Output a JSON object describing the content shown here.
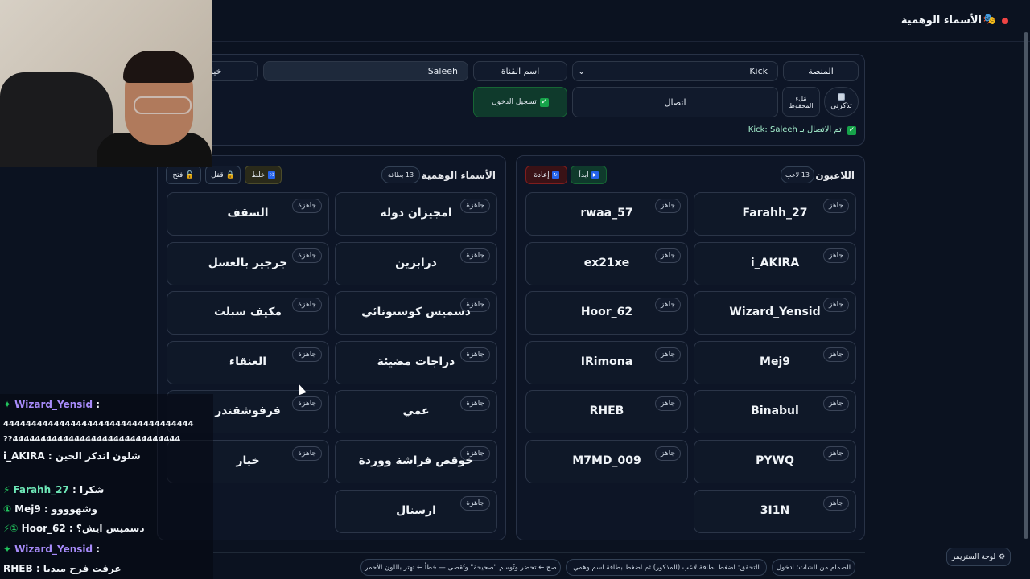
{
  "app": {
    "title": "الأسماء الوهمية",
    "icon": "theater-masks-icon",
    "rec_color": "#ef4444"
  },
  "connection": {
    "platform_label": "المنصة",
    "platform_value": "Kick",
    "channel_placeholder": "اسم القناة",
    "channel_value": "Saleeh",
    "extra_field": "خيا",
    "login_button": "تسجيل الدخول",
    "connect_button": "اتصال",
    "autofill_button": "مَلء المحفوظ",
    "remember_label": "تذكرني",
    "status": "تم الاتصال بـ Kick: Saleeh"
  },
  "players": {
    "title": "اللاعبون",
    "count": "13 لاعب",
    "start_button": "ابدأ",
    "reset_button": "إعادة",
    "ready_label": "جاهز",
    "items": [
      "Farahh_27",
      "rwaa_57",
      "i_AKIRA",
      "ex21xe",
      "Wizard_Yensid",
      "Hoor_62",
      "Mej9",
      "IRimona",
      "Binabul",
      "RHEB",
      "PYWQ",
      "M7MD_009",
      "3I1N"
    ]
  },
  "fake_names": {
    "title": "الأسماء الوهمية",
    "count": "13 بطاقة",
    "shuffle_button": "خلط",
    "lock_button": "قفل",
    "open_button": "فتح",
    "ready_label": "جاهزة",
    "items": [
      "امجيزان دوله",
      "السقف",
      "درابزين",
      "جرجير بالعسل",
      "دسميس كوستونائي",
      "مكيف سبلت",
      "دراجات مضيئة",
      "العنقاء",
      "عمي",
      "فرفوشقندر",
      "خوقص فراشة ووردة",
      "خيار",
      "ارسنال"
    ]
  },
  "footer": {
    "hint_1": "الصمام من الشات: ادخول",
    "hint_2": "التحقق: اضغط بطاقة لاعب (المذكور) ثم اضغط بطاقة اسم وهمي",
    "hint_3": "صح ← تحضر وتُوسم \"صحيحة\" وتُقصى — خطأ ← تهتز باللون الأحمر",
    "dashboard_button": "لوحة الستريمر"
  },
  "chat": [
    {
      "user": "Wizard_Yensid",
      "user_color": "#a78bfa",
      "badge": "✦",
      "message": ""
    },
    {
      "user": "",
      "user_color": "#f1f5f9",
      "badge": "",
      "message": "4444444444444444444444444444444444"
    },
    {
      "user": "",
      "user_color": "#f1f5f9",
      "badge": "",
      "message": "??444444444444444444444444444444"
    },
    {
      "user": "i_AKIRA",
      "user_color": "#f1f5f9",
      "badge": "",
      "message": "شلون اتذكر الحين"
    },
    {
      "user": "Farahh_27",
      "user_color": "#6ee7b7",
      "badge": "⚡",
      "message": "شكرا"
    },
    {
      "user": "Mej9",
      "user_color": "#f1f5f9",
      "badge": "①",
      "message": "وشهوووو"
    },
    {
      "user": "Hoor_62",
      "user_color": "#f1f5f9",
      "badge": "⚡①",
      "message": "دسميس ايش؟"
    },
    {
      "user": "Wizard_Yensid",
      "user_color": "#a78bfa",
      "badge": "✦",
      "message": ""
    },
    {
      "user": "RHEB",
      "user_color": "#f1f5f9",
      "badge": "",
      "message": "عرفت فرح ميديا"
    }
  ]
}
